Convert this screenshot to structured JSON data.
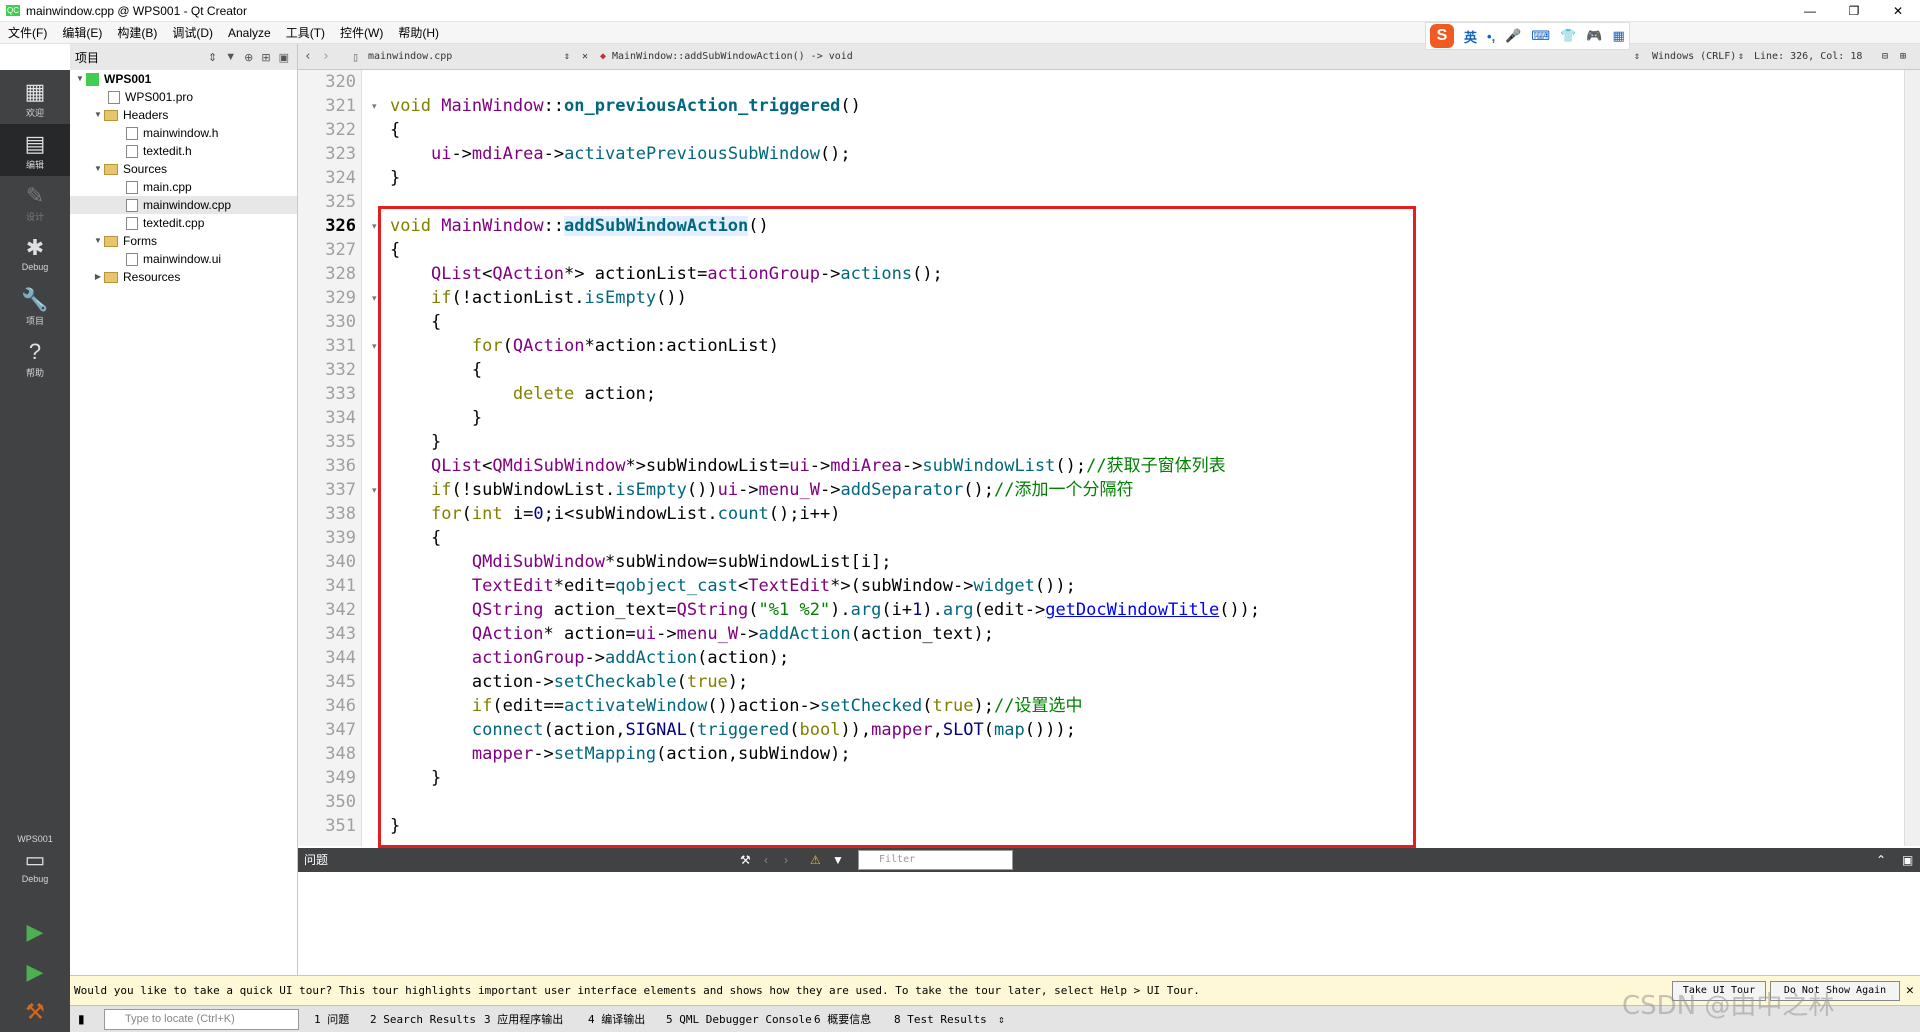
{
  "window": {
    "title": "mainwindow.cpp @ WPS001 - Qt Creator",
    "app_icon": "QC",
    "controls": {
      "minimize": "—",
      "restore": "❐",
      "close": "✕"
    }
  },
  "menubar": [
    "文件(F)",
    "编辑(E)",
    "构建(B)",
    "调试(D)",
    "Analyze",
    "工具(T)",
    "控件(W)",
    "帮助(H)"
  ],
  "ime": {
    "logo": "S",
    "items": [
      "英",
      "•,",
      "🎤",
      "⌨",
      "👕",
      "🎮",
      "▦"
    ]
  },
  "modes": [
    {
      "label": "欢迎",
      "icon": "▦"
    },
    {
      "label": "编辑",
      "icon": "▤"
    },
    {
      "label": "设计",
      "icon": "✎"
    },
    {
      "label": "Debug",
      "icon": "✱"
    },
    {
      "label": "项目",
      "icon": "🔧"
    },
    {
      "label": "帮助",
      "icon": "?"
    }
  ],
  "kit": {
    "project": "WPS001",
    "label": "Debug"
  },
  "project_panel": {
    "title": "项目",
    "tree": [
      {
        "label": "WPS001",
        "kind": "project"
      },
      {
        "label": "WPS001.pro",
        "kind": "file"
      },
      {
        "label": "Headers",
        "kind": "folder"
      },
      {
        "label": "mainwindow.h",
        "kind": "file"
      },
      {
        "label": "textedit.h",
        "kind": "file"
      },
      {
        "label": "Sources",
        "kind": "folder"
      },
      {
        "label": "main.cpp",
        "kind": "file"
      },
      {
        "label": "mainwindow.cpp",
        "kind": "file"
      },
      {
        "label": "textedit.cpp",
        "kind": "file"
      },
      {
        "label": "Forms",
        "kind": "folder"
      },
      {
        "label": "mainwindow.ui",
        "kind": "file"
      },
      {
        "label": "Resources",
        "kind": "folder"
      }
    ]
  },
  "editor_header": {
    "file": "mainwindow.cpp",
    "symbol": "MainWindow::addSubWindowAction() -> void",
    "line_ending": "Windows (CRLF)",
    "position": "Line: 326, Col: 18"
  },
  "editor": {
    "line_numbers": [
      "320",
      "321",
      "322",
      "323",
      "324",
      "325",
      "326",
      "327",
      "328",
      "329",
      "330",
      "331",
      "332",
      "333",
      "334",
      "335",
      "336",
      "337",
      "338",
      "339",
      "340",
      "341",
      "342",
      "343",
      "344",
      "345",
      "346",
      "347",
      "348",
      "349",
      "350",
      "351"
    ],
    "current_line": "326"
  },
  "issues_panel": {
    "title": "问题",
    "filter_placeholder": "Filter"
  },
  "tour": {
    "message": "Would you like to take a quick UI tour? This tour highlights important user interface elements and shows how they are used. To take the tour later, select Help > UI Tour.",
    "take_button": "Take UI Tour",
    "dont_show_button": "Do Not Show Again"
  },
  "statusbar": {
    "locate_placeholder": "Type to locate (Ctrl+K)",
    "tabs": [
      "1 问题",
      "2 Search Results",
      "3 应用程序输出",
      "4 编译输出",
      "5 QML Debugger Console",
      "6 概要信息",
      "8 Test Results"
    ]
  },
  "watermark": "CSDN @由中之林",
  "colors": {
    "keyword": "#808000",
    "type": "#800080",
    "function": "#00677c",
    "comment": "#008000",
    "highlight_box": "#e02020"
  }
}
